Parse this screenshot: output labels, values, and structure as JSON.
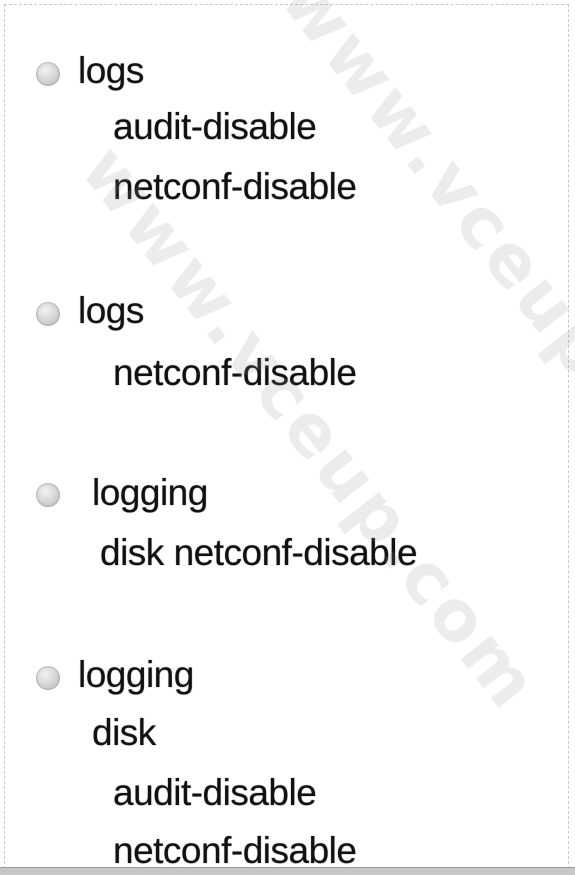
{
  "options": [
    {
      "lines": [
        "logs",
        "audit-disable",
        "netconf-disable"
      ]
    },
    {
      "lines": [
        "logs",
        "netconf-disable"
      ]
    },
    {
      "lines": [
        "logging",
        "disk netconf-disable"
      ]
    },
    {
      "lines": [
        "logging",
        "disk",
        "audit-disable",
        "netconf-disable"
      ]
    }
  ],
  "watermark": {
    "text_a": "www.vceup.com",
    "text_b": "www.vceup.com"
  }
}
